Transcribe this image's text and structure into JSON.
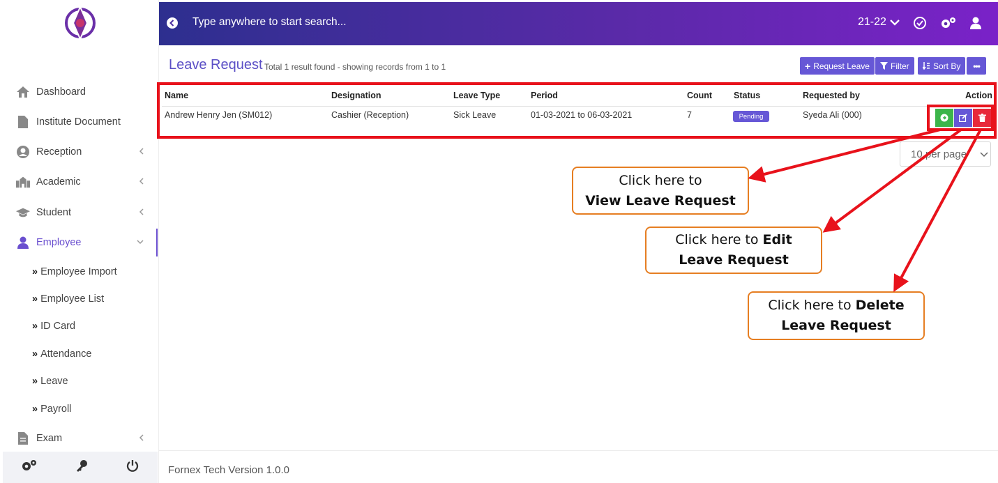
{
  "topbar": {
    "search_placeholder": "Type anywhere to start search...",
    "session_year": "21-22"
  },
  "sidebar": {
    "items": [
      {
        "label": "Dashboard",
        "icon": "home-icon"
      },
      {
        "label": "Institute Document",
        "icon": "document-icon"
      },
      {
        "label": "Reception",
        "icon": "user-circle-icon"
      },
      {
        "label": "Academic",
        "icon": "school-icon"
      },
      {
        "label": "Student",
        "icon": "graduation-cap-icon"
      },
      {
        "label": "Employee",
        "icon": "employee-icon"
      },
      {
        "label": "Exam",
        "icon": "file-icon"
      }
    ],
    "sub_items": [
      "Employee Import",
      "Employee List",
      "ID Card",
      "Attendance",
      "Leave",
      "Payroll"
    ]
  },
  "page": {
    "title": "Leave Request",
    "subtitle": "Total 1 result found - showing records from 1 to 1"
  },
  "toolbar": {
    "request_leave": "Request Leave",
    "filter": "Filter",
    "sort_by": "Sort By"
  },
  "table": {
    "headers": [
      "Name",
      "Designation",
      "Leave Type",
      "Period",
      "Count",
      "Status",
      "Requested by",
      "Action"
    ],
    "rows": [
      {
        "name": "Andrew Henry Jen (SM012)",
        "designation": "Cashier (Reception)",
        "leave_type": "Sick Leave",
        "period": "01-03-2021 to 06-03-2021",
        "count": "7",
        "status": "Pending",
        "requested_by": "Syeda Ali (000)"
      }
    ]
  },
  "pagination": {
    "per_page": "10 per page"
  },
  "callouts": {
    "view": {
      "line1": "Click here to",
      "line2": "View Leave Request"
    },
    "edit": {
      "line1_plain": "Click here to ",
      "line1_bold": "Edit",
      "line2": "Leave Request"
    },
    "delete": {
      "line1_plain": "Click here to ",
      "line1_bold": "Delete",
      "line2": "Leave Request"
    }
  },
  "footer": {
    "version": "Fornex Tech Version 1.0.0"
  },
  "colors": {
    "accent": "#6657d6",
    "highlight": "#e8121b",
    "callout_border": "#e67e22",
    "view": "#3cb54a",
    "edit": "#6657d6",
    "delete": "#e8283a"
  }
}
